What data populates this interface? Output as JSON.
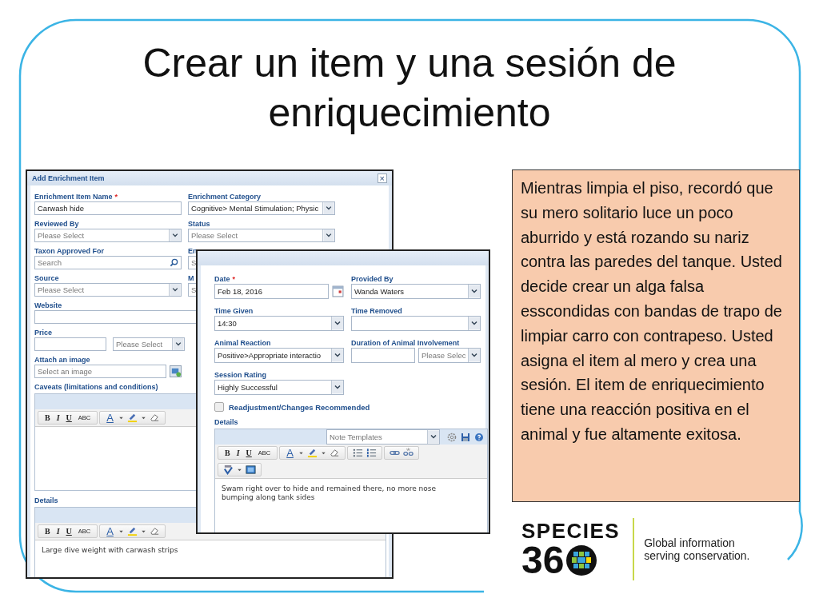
{
  "slide": {
    "title": "Crear un item y una sesión de enriquecimiento"
  },
  "windows": [
    {
      "title": "Add Enrichment Item",
      "close": "×",
      "rows": [
        [
          {
            "label": "Enrichment Item Name",
            "required_mark": "*",
            "kind": "text",
            "value": "Carwash hide"
          },
          {
            "label": "Enrichment Category",
            "kind": "select",
            "value": "Cognitive> Mental Stimulation; Physic"
          }
        ],
        [
          {
            "label": "Reviewed By",
            "kind": "select",
            "placeholder": "Please Select"
          },
          {
            "label": "Status",
            "kind": "select",
            "placeholder": "Please Select"
          }
        ],
        [
          {
            "label": "Taxon Approved For",
            "kind": "search",
            "placeholder": "Search"
          },
          {
            "label": "En",
            "kind": "text",
            "placeholder": "S"
          }
        ],
        [
          {
            "label": "Source",
            "kind": "select",
            "placeholder": "Please Select"
          },
          {
            "label": "M",
            "kind": "text",
            "placeholder": "S"
          }
        ],
        [
          {
            "label": "Website",
            "kind": "wide"
          }
        ],
        [
          {
            "label": "Price",
            "kind": "price",
            "placeholder": "Please Select"
          }
        ],
        [
          {
            "label": "Attach an image",
            "kind": "file",
            "placeholder": "Select an image"
          }
        ]
      ],
      "editors": [
        {
          "label": "Caveats (limitations and conditions)",
          "toolbar_rows": [
            [
              [
                {
                  "kind": "bold",
                  "label": "B"
                },
                {
                  "kind": "italic",
                  "label": "I"
                },
                {
                  "kind": "underline",
                  "label": "U"
                },
                {
                  "kind": "strike",
                  "label": "ABC"
                }
              ],
              [
                {
                  "kind": "font-color",
                  "label": "A"
                },
                {
                  "kind": "dropdown"
                },
                {
                  "kind": "highlight"
                },
                {
                  "kind": "dropdown"
                },
                {
                  "kind": "eraser"
                }
              ]
            ]
          ]
        },
        {
          "label": "Details",
          "text": "Large dive weight with carwash strips",
          "toolbar_rows": [
            [
              [
                {
                  "kind": "bold",
                  "label": "B"
                },
                {
                  "kind": "italic",
                  "label": "I"
                },
                {
                  "kind": "underline",
                  "label": "U"
                },
                {
                  "kind": "strike",
                  "label": "ABC"
                }
              ],
              [
                {
                  "kind": "font-color",
                  "label": "A"
                },
                {
                  "kind": "dropdown"
                },
                {
                  "kind": "highlight"
                },
                {
                  "kind": "dropdown"
                },
                {
                  "kind": "eraser"
                }
              ]
            ]
          ]
        }
      ]
    },
    {
      "rows": [
        [
          {
            "label": "Date",
            "required_mark": "*",
            "kind": "date",
            "value": "Feb 18, 2016"
          },
          {
            "label": "Provided By",
            "kind": "select",
            "value": "Wanda Waters"
          }
        ],
        [
          {
            "label": "Time Given",
            "kind": "select",
            "value": "14:30"
          },
          {
            "label": "Time Removed",
            "kind": "select"
          }
        ],
        [
          {
            "label": "Animal Reaction",
            "kind": "select",
            "value": "Positive>Appropriate interactio"
          },
          {
            "label": "Duration of Animal Involvement",
            "kind": "duration",
            "placeholder": "Please Selec"
          }
        ],
        [
          {
            "label": "Session Rating",
            "kind": "select",
            "value": "Highly Successful"
          }
        ]
      ],
      "checkbox": {
        "label": "Readjustment/Changes Recommended",
        "checked": false
      },
      "editors": [
        {
          "label": "Details",
          "template_placeholder": "Note Templates",
          "text": "Swam right over to hide and remained there, no more nose bumping along tank sides",
          "toolbar_rows": [
            [
              [
                {
                  "kind": "bold",
                  "label": "B"
                },
                {
                  "kind": "italic",
                  "label": "I"
                },
                {
                  "kind": "underline",
                  "label": "U"
                },
                {
                  "kind": "strike",
                  "label": "ABC"
                }
              ],
              [
                {
                  "kind": "font-color",
                  "label": "A"
                },
                {
                  "kind": "dropdown"
                },
                {
                  "kind": "highlight"
                },
                {
                  "kind": "dropdown"
                },
                {
                  "kind": "eraser"
                }
              ],
              [
                {
                  "kind": "bullets"
                },
                {
                  "kind": "numbering"
                }
              ],
              [
                {
                  "kind": "link"
                },
                {
                  "kind": "unlink"
                }
              ]
            ],
            [
              [
                {
                  "kind": "spellcheck"
                },
                {
                  "kind": "dropdown"
                },
                {
                  "kind": "table"
                }
              ]
            ]
          ]
        }
      ]
    }
  ],
  "callout": {
    "text": "Mientras limpia el piso, recordó que su mero solitario luce un poco aburrido y está rozando su nariz contra las paredes del tanque. Usted decide crear un alga falsa esscondidas con bandas de trapo de limpiar carro con contrapeso. Usted asigna el item al mero y crea una sesión. El item de enriquecimiento tiene una reacción positiva en el animal y fue altamente exitosa."
  },
  "logo": {
    "wordmark": "SPECIES",
    "number": "36",
    "tagline": [
      "Global information",
      "serving conservation."
    ]
  }
}
